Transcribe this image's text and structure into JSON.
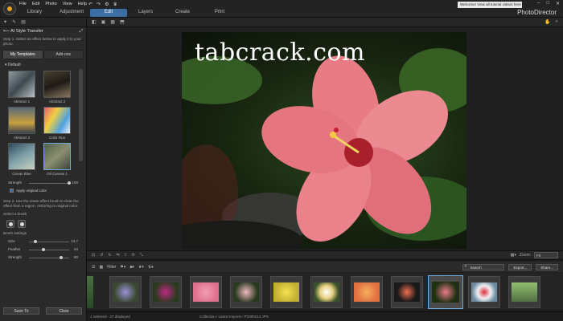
{
  "menus": [
    "File",
    "Edit",
    "Photo",
    "View",
    "Help"
  ],
  "modules": [
    "Library",
    "Adjustment",
    "Edit",
    "Layers",
    "Create",
    "Print"
  ],
  "active_module": "Edit",
  "welcome_text": "Welcome! View all tutorial videos here",
  "app_name": "PhotoDirector",
  "left_panel": {
    "title": "AI Style Transfer",
    "step1": "Step 1. Select an effect below to apply it to your photo.",
    "tabs": [
      "My Templates",
      "Add-ons"
    ],
    "section": "Default",
    "templates": [
      {
        "label": "Abstract 1"
      },
      {
        "label": "Abstract 2"
      },
      {
        "label": "Abstract 3"
      },
      {
        "label": "Color Run"
      },
      {
        "label": "Ocean Blue"
      },
      {
        "label": "Oil Canvas 1"
      }
    ],
    "strength_label": "Strength",
    "strength_value": "100",
    "apply_original": "Apply original color",
    "step2": "Step 2. Use the erase effect brush to clear the effect from a region, restoring to original color.",
    "select_brush": "Select a brush",
    "brush_settings": "Brush settings",
    "size_label": "Size",
    "size_value": "13.7",
    "feather_label": "Feather",
    "feather_value": "34",
    "strength2_label": "Strength",
    "strength2_value": "80",
    "save_to": "Save To",
    "clear": "Clear"
  },
  "watermark": "tabcrack.com",
  "strip": {
    "zoom_label": "Zoom:",
    "zoom_value": "Fit",
    "filter_label": "Filter",
    "search_placeholder": "Search",
    "export_label": "Export...",
    "share_label": "Share..."
  },
  "status": {
    "left": "1 selected - 47 displayed",
    "path": "Collection / Latest Imports / P1000414.JPG"
  },
  "colors": {
    "accent": "#3b6ea5",
    "selection": "#6fa8e0",
    "logo": "#e8a21d",
    "petal": "#e97b85"
  }
}
